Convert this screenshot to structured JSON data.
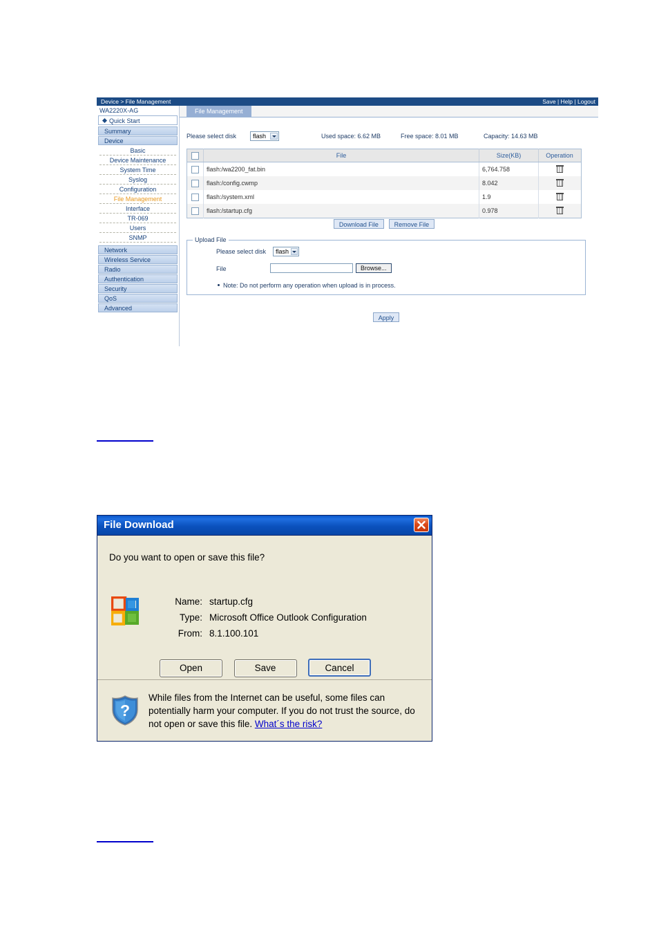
{
  "router_ui": {
    "breadcrumb": "Device > File Management",
    "topright": {
      "save": "Save",
      "help": "Help",
      "logout": "Logout",
      "sep": "|"
    },
    "device_name": "WA2220X-AG",
    "quick_start": "Quick Start",
    "nav_groups": [
      {
        "label": "Summary"
      },
      {
        "label": "Device"
      }
    ],
    "device_subitems": [
      {
        "label": "Basic",
        "active": false
      },
      {
        "label": "Device Maintenance",
        "active": false
      },
      {
        "label": "System Time",
        "active": false
      },
      {
        "label": "Syslog",
        "active": false
      },
      {
        "label": "Configuration",
        "active": false
      },
      {
        "label": "File Management",
        "active": true
      },
      {
        "label": "Interface",
        "active": false
      },
      {
        "label": "TR-069",
        "active": false
      },
      {
        "label": "Users",
        "active": false
      },
      {
        "label": "SNMP",
        "active": false
      }
    ],
    "nav_bottom": [
      {
        "label": "Network"
      },
      {
        "label": "Wireless Service"
      },
      {
        "label": "Radio"
      },
      {
        "label": "Authentication"
      },
      {
        "label": "Security"
      },
      {
        "label": "QoS"
      },
      {
        "label": "Advanced"
      }
    ],
    "tab": "File Management",
    "disk_select": {
      "label": "Please select disk",
      "value": "flash"
    },
    "stats": {
      "used": "Used space: 6.62 MB",
      "free": "Free space: 8.01 MB",
      "capacity": "Capacity: 14.63 MB"
    },
    "table": {
      "headers": {
        "file": "File",
        "size": "Size(KB)",
        "operation": "Operation"
      },
      "rows": [
        {
          "file": "flash:/wa2200_fat.bin",
          "size": "6,764.758"
        },
        {
          "file": "flash:/config.cwmp",
          "size": "8.042"
        },
        {
          "file": "flash:/system.xml",
          "size": "1.9"
        },
        {
          "file": "flash:/startup.cfg",
          "size": "0.978"
        }
      ]
    },
    "actions": {
      "download": "Download File",
      "remove": "Remove File",
      "apply": "Apply"
    },
    "upload": {
      "legend": "Upload File",
      "disk_label": "Please select disk",
      "disk_value": "flash",
      "file_label": "File",
      "file_value": "",
      "browse": "Browse...",
      "note": "Note: Do not perform any operation when upload is in process."
    }
  },
  "file_download_dialog": {
    "title": "File Download",
    "question": "Do you want to open or save this file?",
    "fields": [
      {
        "key": "Name:",
        "value": "startup.cfg"
      },
      {
        "key": "Type:",
        "value": "Microsoft Office Outlook Configuration"
      },
      {
        "key": "From:",
        "value": "8.1.100.101"
      }
    ],
    "buttons": {
      "open": "Open",
      "save": "Save",
      "cancel": "Cancel"
    },
    "warning_text": "While files from the Internet can be useful, some files can potentially harm your computer. If you do not trust the source, do not open or save this file. ",
    "warning_link": "What´s the risk?"
  },
  "colors": {
    "header_blue": "#1c4b85",
    "nav_gradient_top": "#d5e2f3",
    "nav_gradient_bottom": "#bcd0ea",
    "active_nav_orange": "#e8981e",
    "tab_active_bg": "#96afd4",
    "button_bg": "#dfe8f6",
    "dialog_bg": "#ece9d8",
    "dialog_title_blue": "#0b51bd",
    "link_blue": "#0000cc"
  }
}
